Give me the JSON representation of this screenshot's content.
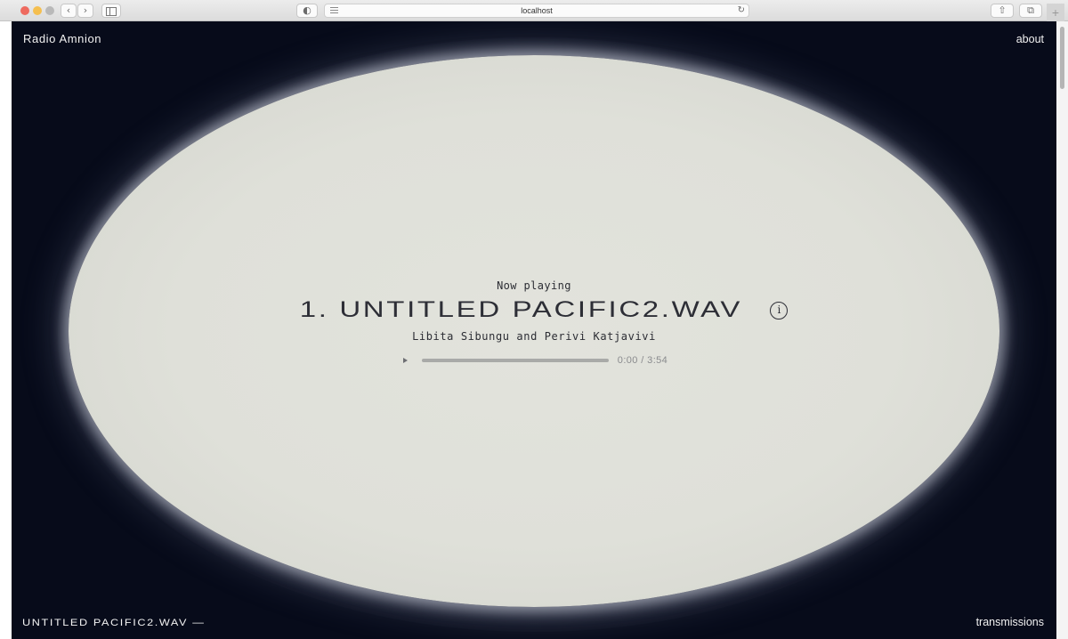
{
  "browser": {
    "url": "localhost",
    "new_tab_label": "+"
  },
  "site": {
    "brand": "Radio Amnion",
    "about_label": "about",
    "transmissions_label": "transmissions"
  },
  "player": {
    "status_label": "Now playing",
    "track_title": "1. UNTITLED PACIFIC2.WAV",
    "info_icon_glyph": "i",
    "artists": "Libita Sibungu and Perivi Katjavivi",
    "current_time": "0:00",
    "duration": "3:54",
    "time_display": "0:00 / 3:54",
    "progress_fraction": 0.0
  },
  "footer": {
    "now_playing_marquee": "UNTITLED PACIFIC2.WAV —"
  },
  "colors": {
    "page_background": "#070b1a",
    "ellipse": "#dfe0d9",
    "text_light": "#f2f2f2",
    "text_dark": "#2d2e36"
  }
}
